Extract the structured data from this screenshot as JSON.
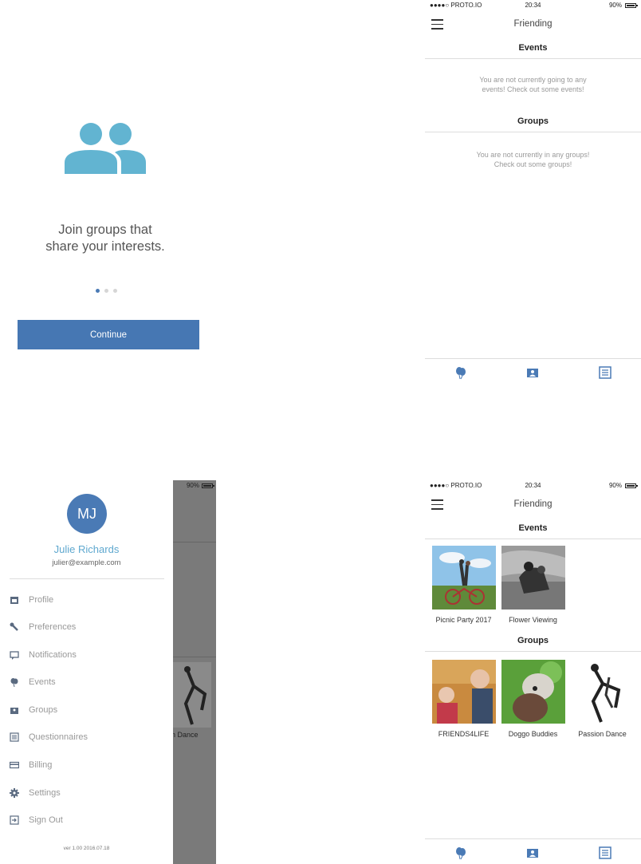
{
  "onboarding": {
    "line1": "Join groups that",
    "line2": "share your interests.",
    "continue_label": "Continue",
    "icon": "people-icon",
    "accent": "#4677b3"
  },
  "status": {
    "carrier": "●●●●○ PROTO.IO",
    "time": "20:34",
    "battery": "90%"
  },
  "screen_empty": {
    "title": "Friending",
    "events_header": "Events",
    "events_empty_1": "You are not currently going to any",
    "events_empty_2": "events!  Check out some events!",
    "groups_header": "Groups",
    "groups_empty_1": "You are not currently in any groups!",
    "groups_empty_2": "Check out some groups!"
  },
  "screen_full": {
    "title": "Friending",
    "events_header": "Events",
    "events": [
      {
        "label": "Picnic Party 2017"
      },
      {
        "label": "Flower Viewing"
      }
    ],
    "groups_header": "Groups",
    "groups": [
      {
        "label": "FRIENDS4LIFE"
      },
      {
        "label": "Doggo Buddies"
      },
      {
        "label": "Passion Dance"
      }
    ]
  },
  "menu": {
    "initials": "MJ",
    "name": "Julie Richards",
    "email": "julier@example.com",
    "items": [
      {
        "label": "Profile",
        "icon": "profile-icon"
      },
      {
        "label": "Preferences",
        "icon": "wrench-icon"
      },
      {
        "label": "Notifications",
        "icon": "chat-icon"
      },
      {
        "label": "Events",
        "icon": "balloons-icon"
      },
      {
        "label": "Groups",
        "icon": "photos-icon"
      },
      {
        "label": "Questionnaires",
        "icon": "list-icon"
      },
      {
        "label": "Billing",
        "icon": "card-icon"
      },
      {
        "label": "Settings",
        "icon": "gear-icon"
      },
      {
        "label": "Sign Out",
        "icon": "signout-icon"
      }
    ],
    "version": "ver 1.00 2016.07.18",
    "behind_label": "n Dance",
    "behind_battery": "90%"
  }
}
